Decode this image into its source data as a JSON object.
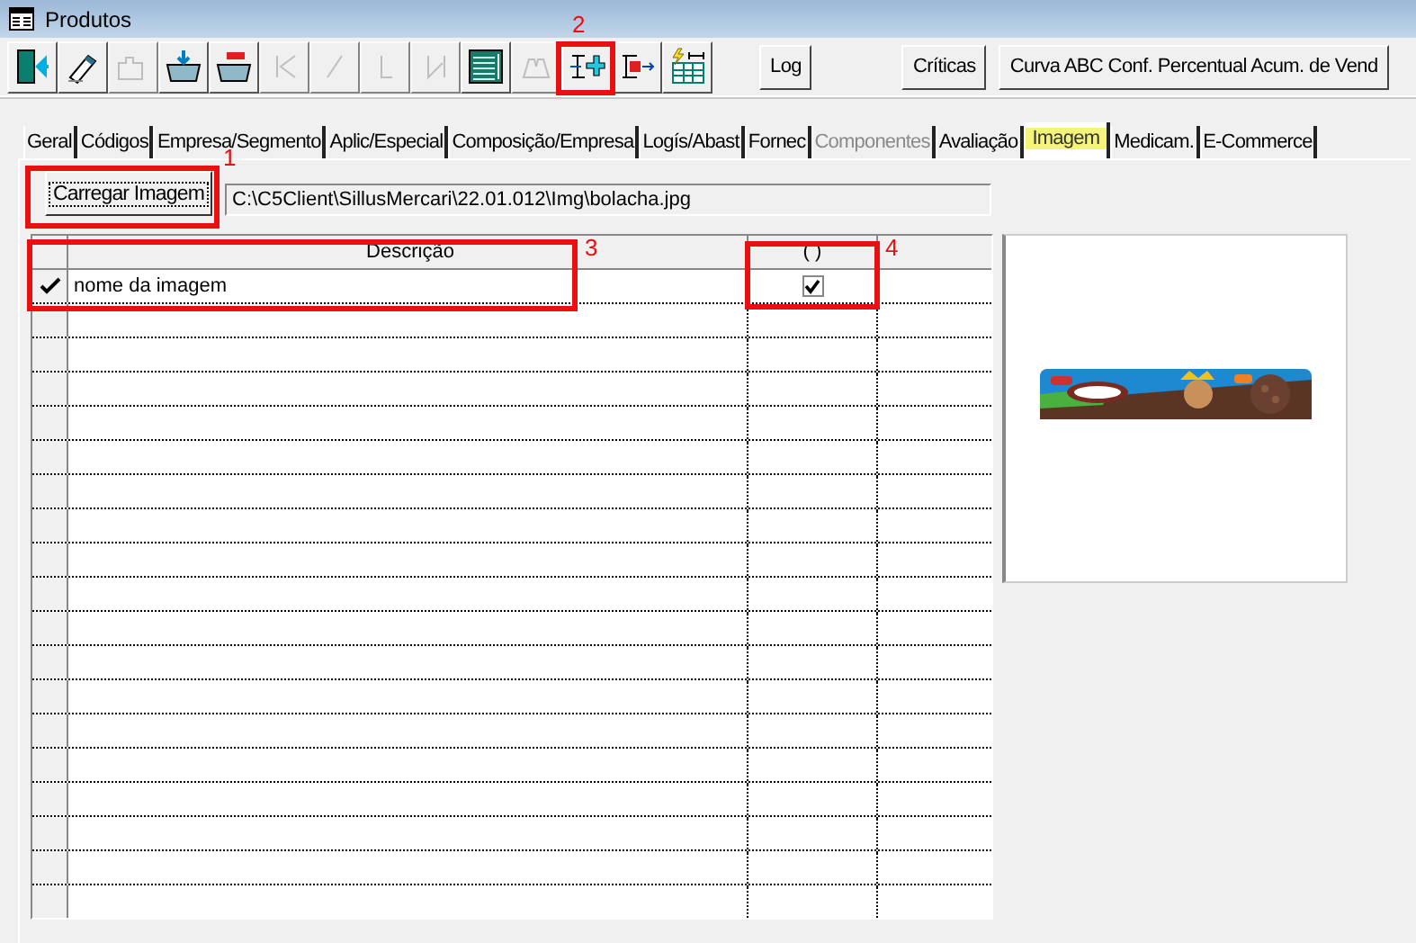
{
  "window": {
    "title": "Produtos"
  },
  "toolbar": [
    {
      "kind": "exit",
      "disabled": false
    },
    {
      "kind": "eraser",
      "disabled": false
    },
    {
      "kind": "puzzle",
      "disabled": true
    },
    {
      "kind": "folder-in",
      "disabled": false
    },
    {
      "kind": "folder-out",
      "disabled": false
    },
    {
      "kind": "first",
      "disabled": true
    },
    {
      "kind": "prev",
      "disabled": true
    },
    {
      "kind": "next",
      "disabled": true
    },
    {
      "kind": "last",
      "disabled": true
    },
    {
      "kind": "grid",
      "disabled": false
    },
    {
      "kind": "binoculars",
      "disabled": true
    },
    {
      "kind": "add",
      "disabled": false
    },
    {
      "kind": "remove",
      "disabled": false
    },
    {
      "kind": "table",
      "disabled": false
    }
  ],
  "buttons": [
    "Log",
    "Críticas",
    "Curva ABC Conf. Percentual Acum. de Vend"
  ],
  "tabs": [
    {
      "label": "Geral",
      "selected": false,
      "disabled": false
    },
    {
      "label": "Códigos",
      "selected": false,
      "disabled": false
    },
    {
      "label": "Empresa/Segmento",
      "selected": false,
      "disabled": false
    },
    {
      "label": "Aplic/Especial",
      "selected": false,
      "disabled": false
    },
    {
      "label": "Composição/Empresa",
      "selected": false,
      "disabled": false
    },
    {
      "label": "Logís/Abast",
      "selected": false,
      "disabled": false
    },
    {
      "label": "Fornec",
      "selected": false,
      "disabled": false
    },
    {
      "label": "Componentes",
      "selected": false,
      "disabled": true
    },
    {
      "label": "Avaliação",
      "selected": false,
      "disabled": false
    },
    {
      "label": "Imagem",
      "selected": true,
      "disabled": false
    },
    {
      "label": "Medicam.",
      "selected": false,
      "disabled": false
    },
    {
      "label": "E-Commerce",
      "selected": false,
      "disabled": false
    }
  ],
  "load_button": "Carregar Imagem",
  "path": "C:\\C5Client\\SillusMercari\\22.01.012\\Img\\bolacha.jpg",
  "grid": {
    "columns": [
      "Descrição",
      "( )"
    ],
    "rows": [
      {
        "description": "nome da imagem",
        "checked": true,
        "selected": true
      }
    ]
  },
  "preview": {
    "kind": "picture"
  },
  "annotations": [
    {
      "label": "1"
    },
    {
      "label": "2"
    },
    {
      "label": "3"
    },
    {
      "label": "4"
    }
  ]
}
